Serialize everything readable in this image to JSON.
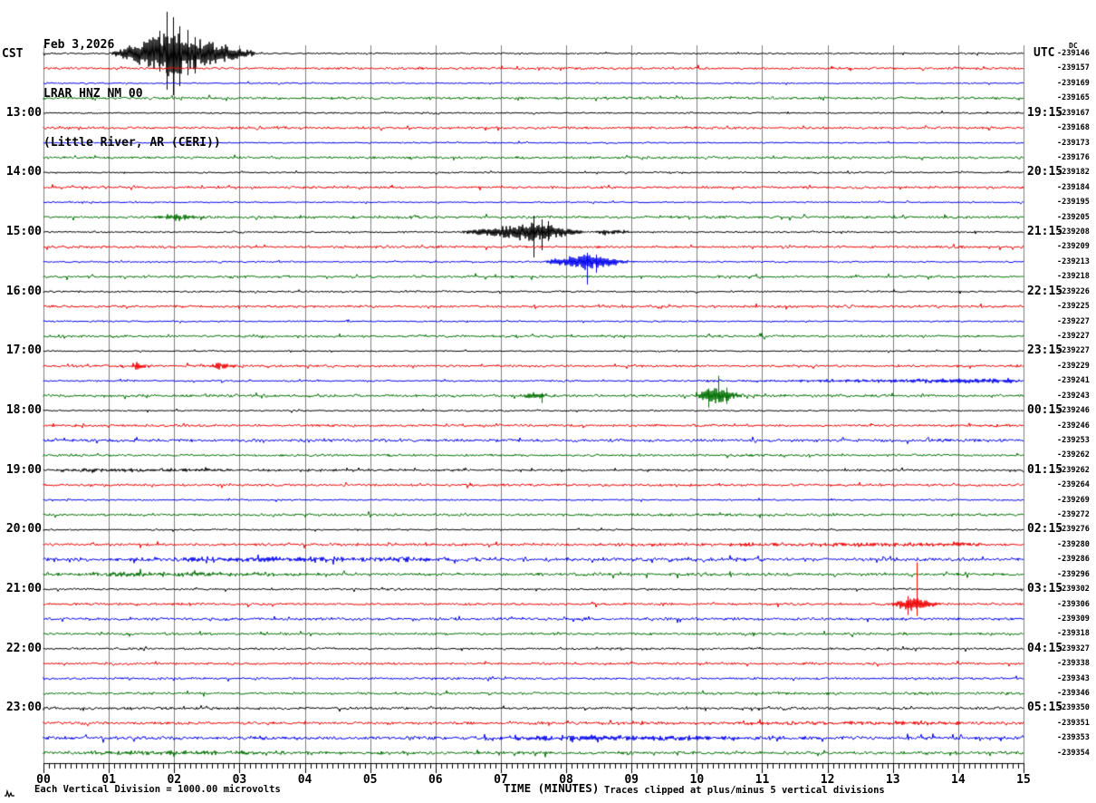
{
  "title": {
    "date": "Feb 3,2026",
    "station": "LRAR HNZ NM 00",
    "location": "(Little River, AR (CERI))"
  },
  "left_axis": {
    "label": "CST",
    "hour_labels": [
      "13:00",
      "14:00",
      "15:00",
      "16:00",
      "17:00",
      "18:00",
      "19:00",
      "20:00",
      "21:00",
      "22:00",
      "23:00"
    ]
  },
  "right_axis": {
    "label": "UTC",
    "dc_label": "DC",
    "hour_labels": [
      "19:15",
      "20:15",
      "21:15",
      "22:15",
      "23:15",
      "00:15",
      "01:15",
      "02:15",
      "03:15",
      "04:15",
      "05:15"
    ],
    "dc_values": [
      "-239146",
      "-239157",
      "-239169",
      "-239165",
      "-239167",
      "-239168",
      "-239173",
      "-239176",
      "-239182",
      "-239184",
      "-239195",
      "-239205",
      "-239208",
      "-239209",
      "-239213",
      "-239218",
      "-239226",
      "-239225",
      "-239227",
      "-239227",
      "-239227",
      "-239229",
      "-239241",
      "-239243",
      "-239246",
      "-239246",
      "-239253",
      "-239262",
      "-239262",
      "-239264",
      "-239269",
      "-239272",
      "-239276",
      "-239280",
      "-239286",
      "-239296",
      "-239302",
      "-239306",
      "-239309",
      "-239318",
      "-239327",
      "-239338",
      "-239343",
      "-239346",
      "-239350",
      "-239351",
      "-239353",
      "-239354"
    ]
  },
  "x_axis": {
    "label": "TIME (MINUTES)",
    "ticks": [
      "00",
      "01",
      "02",
      "03",
      "04",
      "05",
      "06",
      "07",
      "08",
      "09",
      "10",
      "11",
      "12",
      "13",
      "14",
      "15"
    ]
  },
  "footer": {
    "left": "Each Vertical Division = 1000.00 microvolts",
    "right": "Traces clipped at plus/minus 5 vertical divisions"
  },
  "colors": {
    "trace_cycle": [
      "#000000",
      "#ee0000",
      "#0000ee",
      "#007000"
    ],
    "grid": "#7f7f7f",
    "axis": "#000000"
  },
  "chart_data": {
    "type": "seismogram-helicorder",
    "minutes_per_line": 15,
    "x_range_minutes": [
      0,
      15
    ],
    "num_rows": 48,
    "row_color_cycle": [
      "black",
      "red",
      "blue",
      "green"
    ],
    "rows_base_amp": [
      1.0,
      1.4,
      0.8,
      1.5,
      0.9,
      1.4,
      0.8,
      1.4,
      0.9,
      1.4,
      0.8,
      1.5,
      0.9,
      1.4,
      0.9,
      1.4,
      1.0,
      1.4,
      0.9,
      1.4,
      0.8,
      1.4,
      1.0,
      1.6,
      0.9,
      1.4,
      1.7,
      1.4,
      1.2,
      1.4,
      0.9,
      1.4,
      0.9,
      1.5,
      2.1,
      1.7,
      1.1,
      1.4,
      1.6,
      1.4,
      1.3,
      1.4,
      1.3,
      1.4,
      1.5,
      1.6,
      2.0,
      1.8
    ],
    "events": [
      {
        "row": 0,
        "t0": 1.0,
        "tp": 1.95,
        "t1": 3.4,
        "amp": 26,
        "spikes": [
          [
            1.78,
            25,
            20
          ],
          [
            1.88,
            46,
            40
          ],
          [
            1.98,
            40,
            46
          ],
          [
            2.08,
            30,
            36
          ],
          [
            2.2,
            26,
            24
          ],
          [
            2.32,
            18,
            22
          ]
        ]
      },
      {
        "row": 0,
        "t0": 2.4,
        "tp": 2.6,
        "t1": 3.2,
        "amp": 8,
        "spikes": []
      },
      {
        "row": 11,
        "t0": 1.6,
        "tp": 2.0,
        "t1": 2.6,
        "amp": 3.5,
        "spikes": []
      },
      {
        "row": 12,
        "t0": 6.3,
        "tp": 7.55,
        "t1": 8.4,
        "amp": 11,
        "spikes": [
          [
            7.5,
            18,
            28
          ],
          [
            7.62,
            14,
            20
          ],
          [
            7.72,
            12,
            10
          ]
        ]
      },
      {
        "row": 12,
        "t0": 8.4,
        "tp": 8.6,
        "t1": 9.2,
        "amp": 3,
        "spikes": []
      },
      {
        "row": 14,
        "t0": 7.6,
        "tp": 8.3,
        "t1": 9.1,
        "amp": 10,
        "spikes": [
          [
            8.32,
            10,
            25
          ],
          [
            8.45,
            8,
            12
          ]
        ]
      },
      {
        "row": 21,
        "t0": 1.3,
        "tp": 1.45,
        "t1": 1.7,
        "amp": 4,
        "spikes": []
      },
      {
        "row": 21,
        "t0": 2.5,
        "tp": 2.68,
        "t1": 3.05,
        "amp": 4.5,
        "spikes": []
      },
      {
        "row": 22,
        "t0": 9.0,
        "tp": 14.8,
        "t1": 15.0,
        "amp": 2.3,
        "spikes": []
      },
      {
        "row": 23,
        "t0": 7.25,
        "tp": 7.5,
        "t1": 7.9,
        "amp": 3,
        "spikes": [
          [
            7.62,
            3,
            8
          ]
        ]
      },
      {
        "row": 23,
        "t0": 9.9,
        "tp": 10.28,
        "t1": 10.8,
        "amp": 10,
        "spikes": [
          [
            10.33,
            22,
            7
          ],
          [
            10.18,
            8,
            13
          ],
          [
            10.45,
            9,
            9
          ]
        ]
      },
      {
        "row": 28,
        "t0": 0.0,
        "tp": 0.3,
        "t1": 7.0,
        "amp": 1.6,
        "spikes": []
      },
      {
        "row": 33,
        "t0": 7.0,
        "tp": 14.0,
        "t1": 15.0,
        "amp": 1.7,
        "spikes": []
      },
      {
        "row": 34,
        "t0": 0.3,
        "tp": 3.5,
        "t1": 8.5,
        "amp": 2.4,
        "spikes": []
      },
      {
        "row": 35,
        "t0": 0.0,
        "tp": 1.5,
        "t1": 6.0,
        "amp": 2.0,
        "spikes": []
      },
      {
        "row": 37,
        "t0": 12.95,
        "tp": 13.28,
        "t1": 13.8,
        "amp": 9,
        "spikes": [
          [
            13.36,
            46,
            13
          ],
          [
            13.22,
            9,
            12
          ]
        ]
      },
      {
        "row": 45,
        "t0": 9.0,
        "tp": 13.0,
        "t1": 15.0,
        "amp": 1.6,
        "spikes": []
      },
      {
        "row": 46,
        "t0": 5.5,
        "tp": 8.5,
        "t1": 13.5,
        "amp": 2.2,
        "spikes": []
      },
      {
        "row": 47,
        "t0": 0.0,
        "tp": 2.0,
        "t1": 7.0,
        "amp": 1.8,
        "spikes": []
      }
    ],
    "clip_divisions": 5,
    "hour_label_row_step": 4,
    "left_hour_rows_start": 4
  }
}
